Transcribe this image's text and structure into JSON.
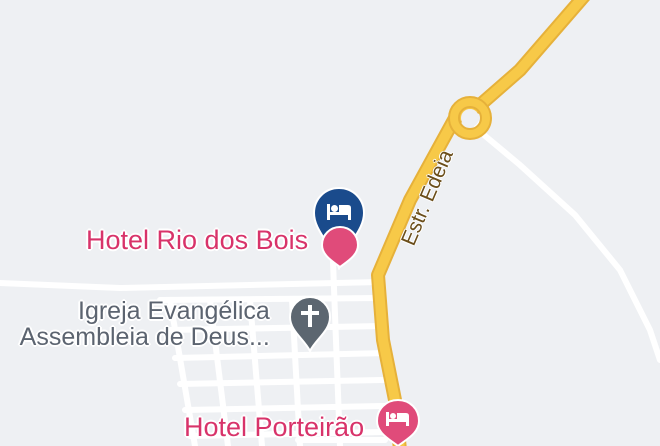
{
  "map": {
    "background_color": "#eef0f3",
    "street_color": "#ffffff",
    "highway_color": "#f7c948",
    "highway_casing_color": "#e6b13a"
  },
  "pois": {
    "selected_hotel": {
      "name": "Hotel Rio dos Bois",
      "category": "hotel",
      "icon": "bed-icon",
      "pin_color": "#1a4b8c",
      "label_color": "#d8336a"
    },
    "church": {
      "name_line1": "Igreja Evangélica",
      "name_line2": "Assembleia de Deus...",
      "category": "church",
      "icon": "cross-icon",
      "pin_color": "#5c6670"
    },
    "hotel_porteirao": {
      "name": "Hotel Porteirão",
      "category": "hotel",
      "icon": "bed-icon",
      "pin_color": "#e04b7a",
      "label_color": "#d8336a"
    }
  },
  "roads": {
    "highway_name": "Estr. Edeia"
  }
}
